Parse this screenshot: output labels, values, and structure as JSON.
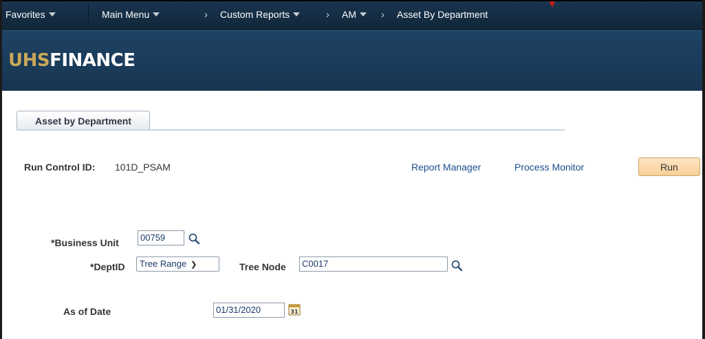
{
  "nav": {
    "favorites": "Favorites",
    "main_menu": "Main Menu",
    "custom_reports": "Custom Reports",
    "am": "AM",
    "asset_by_department": "Asset By Department"
  },
  "banner": {
    "logo_part1": "UHS",
    "logo_part2": "FINANCE"
  },
  "tab": {
    "label": "Asset by Department"
  },
  "run_control": {
    "label": "Run Control ID:",
    "value": "101D_PSAM",
    "report_manager": "Report Manager",
    "process_monitor": "Process Monitor",
    "run_button": "Run"
  },
  "form": {
    "business_unit_label": "*Business Unit",
    "business_unit_value": "00759",
    "deptid_label": "*DeptID",
    "deptid_value": "Tree Range",
    "tree_node_label": "Tree Node",
    "tree_node_value": "C0017",
    "as_of_date_label": "As of Date",
    "as_of_date_value": "01/31/2020",
    "calendar_day": "31"
  },
  "colors": {
    "navbar": "#102538",
    "banner": "#1f4364",
    "logo_accent": "#c8a85a",
    "run_button": "#f7cf97",
    "link": "#1a4f8b"
  }
}
